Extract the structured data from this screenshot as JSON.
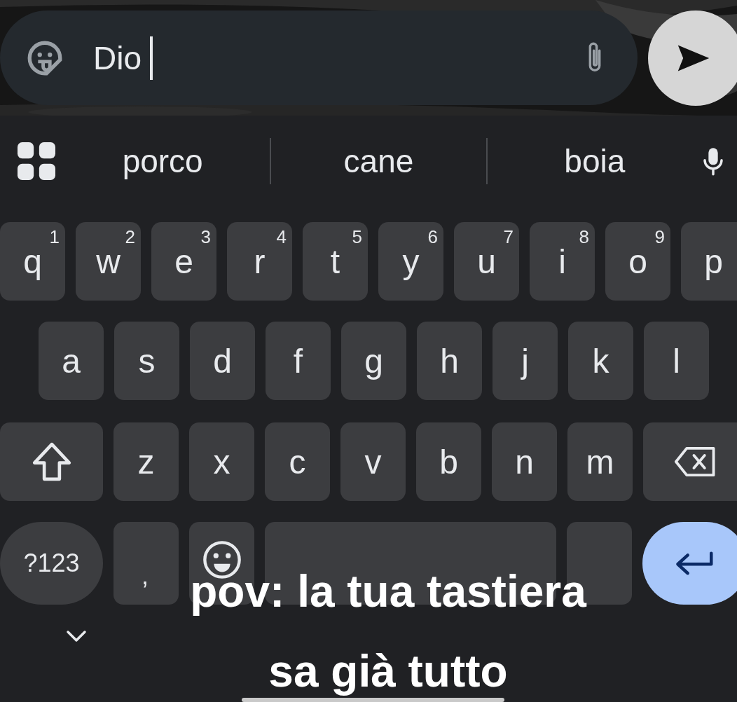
{
  "message_field": {
    "value": "Dio"
  },
  "suggestions": [
    "porco",
    "cane",
    "boia"
  ],
  "key_rows": [
    [
      {
        "label": "q",
        "hint": "1"
      },
      {
        "label": "w",
        "hint": "2"
      },
      {
        "label": "e",
        "hint": "3"
      },
      {
        "label": "r",
        "hint": "4"
      },
      {
        "label": "t",
        "hint": "5"
      },
      {
        "label": "y",
        "hint": "6"
      },
      {
        "label": "u",
        "hint": "7"
      },
      {
        "label": "i",
        "hint": "8"
      },
      {
        "label": "o",
        "hint": "9"
      },
      {
        "label": "p"
      }
    ],
    [
      {
        "label": "a"
      },
      {
        "label": "s"
      },
      {
        "label": "d"
      },
      {
        "label": "f"
      },
      {
        "label": "g"
      },
      {
        "label": "h"
      },
      {
        "label": "j"
      },
      {
        "label": "k"
      },
      {
        "label": "l"
      }
    ],
    [
      {
        "kind": "shift"
      },
      {
        "kind": "letter",
        "label": "z"
      },
      {
        "kind": "letter",
        "label": "x"
      },
      {
        "kind": "letter",
        "label": "c"
      },
      {
        "kind": "letter",
        "label": "v"
      },
      {
        "kind": "letter",
        "label": "b"
      },
      {
        "kind": "letter",
        "label": "n"
      },
      {
        "kind": "letter",
        "label": "m"
      },
      {
        "kind": "backspace"
      }
    ],
    [
      {
        "kind": "symbols",
        "label": "?123"
      },
      {
        "kind": "comma",
        "label": ","
      },
      {
        "kind": "emoji"
      },
      {
        "kind": "space"
      },
      {
        "kind": "blank"
      },
      {
        "kind": "enter"
      }
    ]
  ],
  "caption": [
    "pov: la tua tastiera",
    "sa già tutto"
  ]
}
